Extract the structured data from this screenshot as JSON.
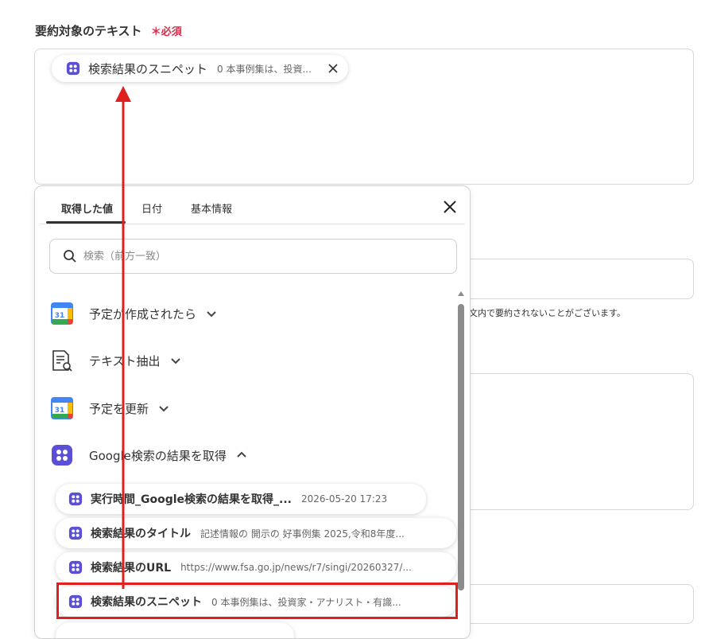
{
  "form": {
    "label": "要約対象のテキスト",
    "required_mark": "＊必須",
    "note_fragment": "文内で要約されないことがございます。"
  },
  "top_chip": {
    "title": "検索結果のスニペット",
    "value": "0 本事例集は、投資..."
  },
  "panel": {
    "tabs": [
      {
        "label": "取得した値",
        "active": true
      },
      {
        "label": "日付",
        "active": false
      },
      {
        "label": "基本情報",
        "active": false
      }
    ],
    "search_placeholder": "検索（前方一致）",
    "groups": [
      {
        "title": "予定が作成されたら",
        "icon": "google-calendar-icon",
        "expanded": false
      },
      {
        "title": "テキスト抽出",
        "icon": "document-search-icon",
        "expanded": false
      },
      {
        "title": "予定を更新",
        "icon": "google-calendar-icon",
        "expanded": false
      },
      {
        "title": "Google検索の結果を取得",
        "icon": "yoom-icon",
        "expanded": true
      }
    ],
    "items": [
      {
        "title": "実行時間_Google検索の結果を取得_...",
        "value": "2026-05-20 17:23"
      },
      {
        "title": "検索結果のタイトル",
        "value": "記述情報の 開示の 好事例集 2025,令和8年度..."
      },
      {
        "title": "検索結果のURL",
        "value": "https://www.fsa.go.jp/news/r7/singi/20260327/..."
      },
      {
        "title": "検索結果のスニペット",
        "value": "0 本事例集は、投資家・アナリスト・有識..."
      }
    ]
  },
  "colors": {
    "accent_red": "#e01f1f",
    "required_red": "#e0284a",
    "yoom_purple": "#5a4fd6"
  },
  "calendar_day": "31"
}
